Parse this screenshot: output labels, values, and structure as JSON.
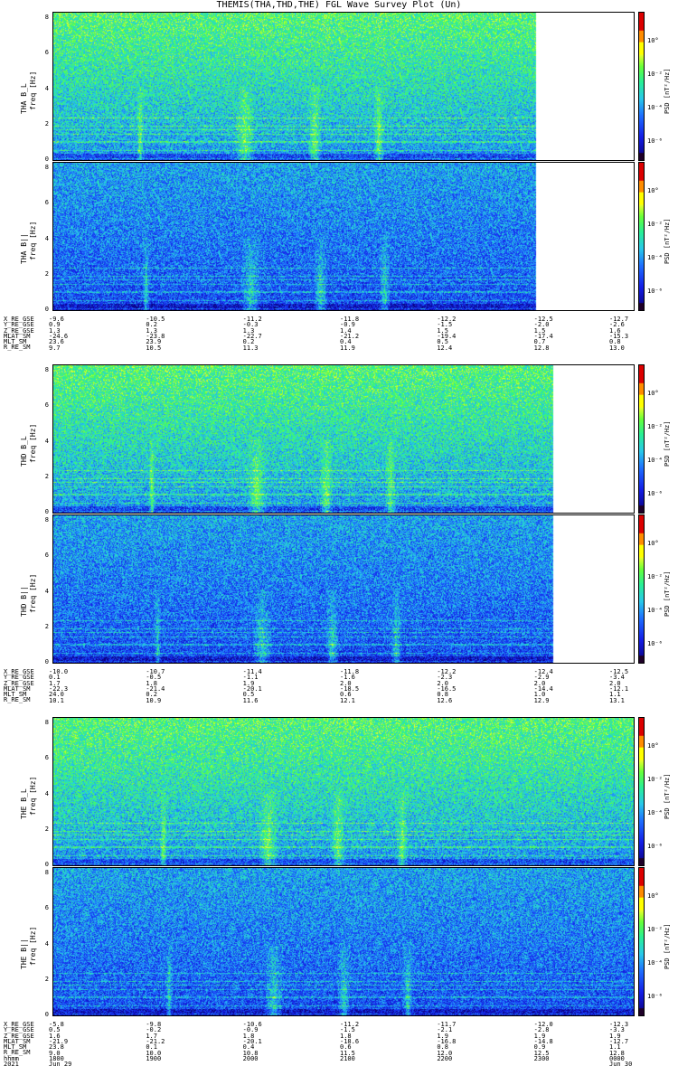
{
  "title": "THEMIS(THA,THD,THE) FGL Wave Survey Plot (Un)",
  "colorbar": {
    "label": "PSD [nT²/Hz]",
    "ticks": [
      "10°",
      "10⁻²",
      "10⁻⁴",
      "10⁻⁶"
    ]
  },
  "groups": [
    {
      "panels": [
        {
          "ylabel": "THA B_L",
          "freq_label": "freq [Hz]",
          "band": "perp"
        },
        {
          "ylabel": "THA B||",
          "freq_label": "freq [Hz]",
          "band": "para"
        }
      ],
      "data_extent": 0.83,
      "eph_labels": [
        "X_RE_GSE",
        "Y_RE_GSE",
        "Z_RE_GSE",
        "MLAT_SM",
        "MLT_SM",
        "R_RE_SM"
      ],
      "eph_columns": [
        [
          "-9.6",
          "0.9",
          "1.3",
          "-24.6",
          "23.6",
          "9.7"
        ],
        [
          "-10.5",
          "0.2",
          "1.3",
          "-23.8",
          "23.9",
          "10.5"
        ],
        [
          "-11.2",
          "-0.3",
          "1.3",
          "-22.7",
          "0.2",
          "11.3"
        ],
        [
          "-11.8",
          "-0.9",
          "1.4",
          "-21.2",
          "0.4",
          "11.9"
        ],
        [
          "-12.2",
          "-1.5",
          "1.5",
          "-19.4",
          "0.5",
          "12.4"
        ],
        [
          "-12.5",
          "-2.0",
          "1.5",
          "-17.4",
          "0.7",
          "12.8"
        ],
        [
          "-12.7",
          "-2.6",
          "1.6",
          "-15.3",
          "0.8",
          "13.0"
        ]
      ]
    },
    {
      "panels": [
        {
          "ylabel": "THD B_L",
          "freq_label": "freq [Hz]",
          "band": "perp"
        },
        {
          "ylabel": "THD B||",
          "freq_label": "freq [Hz]",
          "band": "para"
        }
      ],
      "data_extent": 0.86,
      "eph_labels": [
        "X_RE_GSE",
        "Y_RE_GSE",
        "Z_RE_GSE",
        "MLAT_SM",
        "MLT_SM",
        "R_RE_SM"
      ],
      "eph_columns": [
        [
          "-10.0",
          "0.1",
          "1.7",
          "-22.3",
          "24.0",
          "10.1"
        ],
        [
          "-10.7",
          "-0.5",
          "1.8",
          "-21.4",
          "0.2",
          "10.9"
        ],
        [
          "-11.4",
          "-1.1",
          "1.9",
          "-20.1",
          "0.5",
          "11.6"
        ],
        [
          "-11.8",
          "-1.6",
          "2.0",
          "-18.5",
          "0.6",
          "12.1"
        ],
        [
          "-12.2",
          "-2.3",
          "2.0",
          "-16.5",
          "0.8",
          "12.6"
        ],
        [
          "-12.4",
          "-2.9",
          "2.0",
          "-14.4",
          "1.0",
          "12.9"
        ],
        [
          "-12.5",
          "-3.4",
          "2.0",
          "-12.1",
          "1.1",
          "13.1"
        ]
      ]
    },
    {
      "panels": [
        {
          "ylabel": "THE B_L",
          "freq_label": "freq [Hz]",
          "band": "perp"
        },
        {
          "ylabel": "THE B||",
          "freq_label": "freq [Hz]",
          "band": "para"
        }
      ],
      "data_extent": 1.0,
      "eph_labels": [
        "X_RE_GSE",
        "Y_RE_GSE",
        "Z_RE_GSE",
        "MLAT_SM",
        "MLT_SM",
        "R_RE_SM",
        "hhmm",
        "2021"
      ],
      "eph_columns": [
        [
          "-5.8",
          "0.5",
          "1.6",
          "-21.9",
          "23.8",
          "9.0",
          "1800",
          "Jun 29"
        ],
        [
          "-9.8",
          "-0.2",
          "1.7",
          "-21.2",
          "0.1",
          "10.0",
          "1900",
          ""
        ],
        [
          "-10.6",
          "-0.9",
          "1.8",
          "-20.1",
          "0.4",
          "10.8",
          "2000",
          ""
        ],
        [
          "-11.2",
          "-1.5",
          "1.8",
          "-18.6",
          "0.6",
          "11.5",
          "2100",
          ""
        ],
        [
          "-11.7",
          "-2.1",
          "1.9",
          "-16.8",
          "0.8",
          "12.0",
          "2200",
          ""
        ],
        [
          "-12.0",
          "-2.8",
          "1.9",
          "-14.8",
          "0.9",
          "12.5",
          "2300",
          ""
        ],
        [
          "-12.3",
          "-3.3",
          "1.9",
          "-12.7",
          "1.1",
          "12.8",
          "0000",
          "Jun 30"
        ]
      ]
    }
  ],
  "yticks": [
    "8",
    "6",
    "4",
    "2",
    "0"
  ],
  "chart_data": {
    "type": "heatmap",
    "title": "THEMIS(THA,THD,THE) FGL Wave Survey Plot (Un)",
    "x": [
      "1800",
      "1900",
      "2000",
      "2100",
      "2200",
      "2300",
      "0000"
    ],
    "xlabel": "hhmm",
    "ylabel": "freq [Hz]",
    "ylim": [
      0,
      8
    ],
    "colorbar_label": "PSD [nT²/Hz]",
    "color_scale": "log",
    "series": [
      {
        "name": "THA B_L"
      },
      {
        "name": "THA B||"
      },
      {
        "name": "THD B_L"
      },
      {
        "name": "THD B||"
      },
      {
        "name": "THE B_L"
      },
      {
        "name": "THE B||"
      }
    ]
  }
}
